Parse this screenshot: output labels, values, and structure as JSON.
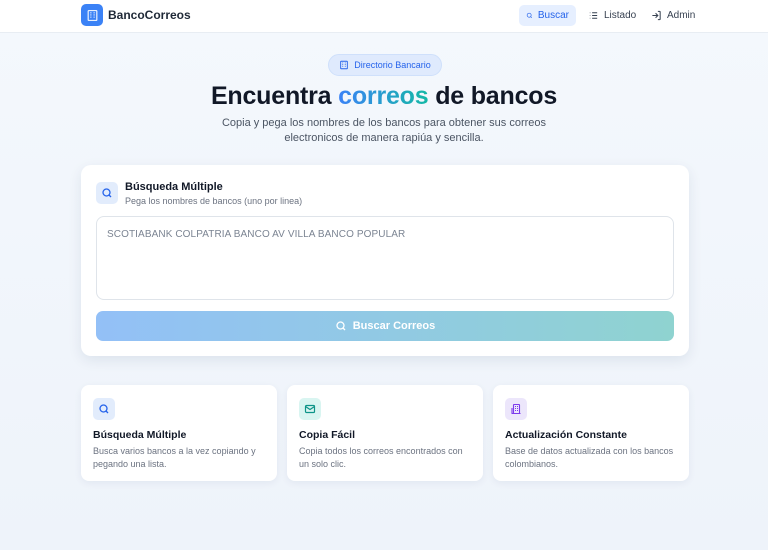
{
  "header": {
    "brand": "BancoCorreos",
    "nav": [
      {
        "label": "Buscar",
        "icon": "search-icon",
        "active": true
      },
      {
        "label": "Listado",
        "icon": "list-icon",
        "active": false
      },
      {
        "label": "Admin",
        "icon": "login-icon",
        "active": false
      }
    ]
  },
  "badge": {
    "label": "Directorio Bancario",
    "icon": "bank-icon"
  },
  "hero": {
    "title_before": "Encuentra ",
    "title_accent": "correos",
    "title_after": " de bancos",
    "subtitle": "Copia y pega los nombres de los bancos para obtener sus correos electronicos de manera rapiúa y sencilla."
  },
  "search": {
    "title": "Búsqueda Múltiple",
    "subtitle": "Pega los nombres de bancos (uno por linea)",
    "placeholder": "SCOTIABANK COLPATRIA BANCO AV VILLA BANCO POPULAR",
    "button_label": "Buscar Correos"
  },
  "features": [
    {
      "title": "Búsqueda Múltiple",
      "desc": "Busca varios bancos a la vez copiando y pegando una lista.",
      "icon": "search-icon"
    },
    {
      "title": "Copia Fácil",
      "desc": "Copia todos los correos encontrados con un solo clic.",
      "icon": "mail-icon"
    },
    {
      "title": "Actualización Constante",
      "desc": "Base de datos actualizada con los bancos colombianos.",
      "icon": "building-icon"
    }
  ],
  "colors": {
    "accent": "#3b82f6",
    "accent_teal": "#14b8a6",
    "feature_icon_purple": "#7c3aed"
  }
}
